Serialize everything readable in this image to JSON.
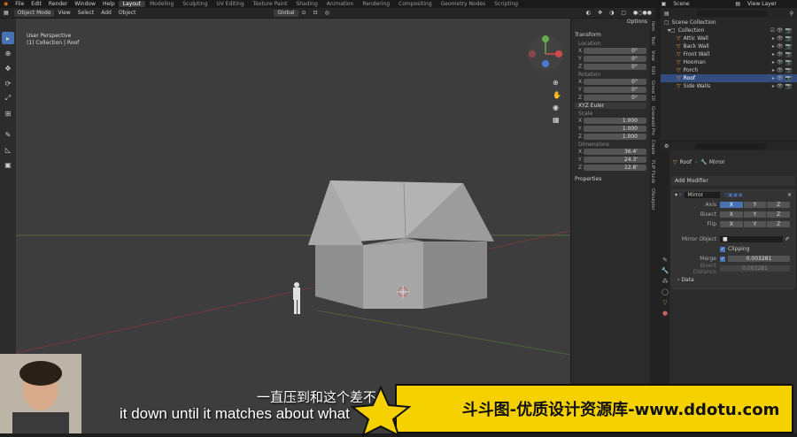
{
  "topbar": {
    "menus": [
      "File",
      "Edit",
      "Render",
      "Window",
      "Help"
    ],
    "workspaces": [
      "Layout",
      "Modeling",
      "Sculpting",
      "UV Editing",
      "Texture Paint",
      "Shading",
      "Animation",
      "Rendering",
      "Compositing",
      "Geometry Nodes",
      "Scripting"
    ],
    "active_workspace": "Layout",
    "scene": "Scene",
    "view_layer": "View Layer"
  },
  "header": {
    "mode": "Object Mode",
    "menus": [
      "View",
      "Select",
      "Add",
      "Object"
    ],
    "transform_orientation": "Global",
    "options": "Options"
  },
  "viewport": {
    "perspective": "User Perspective",
    "collection_path": "(1) Collection | Roof"
  },
  "npanel": {
    "transform_title": "Transform",
    "location_label": "Location",
    "location": [
      {
        "axis": "X",
        "value": "0°"
      },
      {
        "axis": "Y",
        "value": "0°"
      },
      {
        "axis": "Z",
        "value": "0°"
      }
    ],
    "rotation_label": "Rotation",
    "rotation": [
      {
        "axis": "X",
        "value": "0°"
      },
      {
        "axis": "Y",
        "value": "0°"
      },
      {
        "axis": "Z",
        "value": "0°"
      }
    ],
    "rotation_mode": "XYZ Euler",
    "scale_label": "Scale",
    "scale": [
      {
        "axis": "X",
        "value": "1.000"
      },
      {
        "axis": "Y",
        "value": "1.000"
      },
      {
        "axis": "Z",
        "value": "1.000"
      }
    ],
    "dimensions_label": "Dimensions",
    "dimensions": [
      {
        "axis": "X",
        "value": "36.4'"
      },
      {
        "axis": "Y",
        "value": "24.3'"
      },
      {
        "axis": "Z",
        "value": "12.8'"
      }
    ],
    "properties_label": "Properties"
  },
  "sidetabs": [
    "Item",
    "Tool",
    "View",
    "Edit",
    "Grove 10",
    "Graswald Pro",
    "Create",
    "FLIP Fluids",
    "OSculptor"
  ],
  "outliner": {
    "scene_collection": "Scene Collection",
    "collection": "Collection",
    "items": [
      "Attic Wall",
      "Back Wall",
      "Front Wall",
      "Hooman",
      "Porch",
      "Roof",
      "Side Walls"
    ]
  },
  "properties": {
    "object_name": "Roof",
    "modifier_name_header": "Mirror",
    "add_modifier": "Add Modifier",
    "modifier_name": "Mirror",
    "axis_label": "Axis",
    "bisect_label": "Bisect",
    "flip_label": "Flip",
    "axes": [
      "X",
      "Y",
      "Z"
    ],
    "mirror_object_label": "Mirror Object",
    "clipping_label": "Clipping",
    "merge_label": "Merge",
    "merge_value": "0.003281",
    "bisect_distance_label": "Bisect Distance",
    "bisect_distance_value": "0.003281",
    "data_label": "Data"
  },
  "subtitles": {
    "chinese": "一直压到和这个差不",
    "english": "it down until it matches about what"
  },
  "watermark": "斗斗图-优质设计资源库-www.ddotu.com",
  "colors": {
    "accent": "#4772b3",
    "viewport": "#3d3d3d",
    "watermark_bg": "#f5d100",
    "object_orange": "#e8a04a"
  }
}
